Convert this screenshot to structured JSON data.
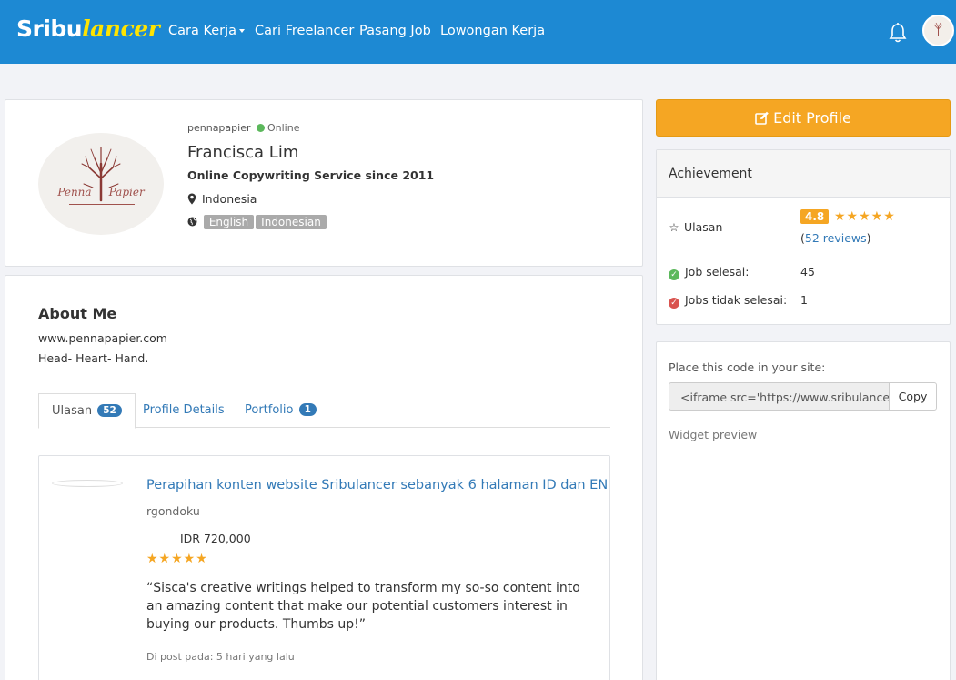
{
  "navbar": {
    "logo_white": "Sribu",
    "logo_yellow": "lancer",
    "items": [
      {
        "label": "Cara Kerja",
        "has_caret": true
      },
      {
        "label": "Cari Freelancer"
      },
      {
        "label": "Pasang Job"
      },
      {
        "label": "Lowongan Kerja"
      }
    ],
    "bell_icon": "bell-icon",
    "avatar_icon": "user-avatar"
  },
  "profile": {
    "username": "pennapapier",
    "status": "Online",
    "name": "Francisca Lim",
    "tagline": "Online Copywriting Service since 2011",
    "location": "Indonesia",
    "languages": [
      "English",
      "Indonesian"
    ],
    "photo_text_1": "Penna",
    "photo_text_2": "Papier"
  },
  "about": {
    "title": "About Me",
    "lines": [
      "www.pennapapier.com",
      "Head- Heart- Hand."
    ]
  },
  "tabs": [
    {
      "label": "Ulasan",
      "badge": "52",
      "active": true
    },
    {
      "label": "Profile Details"
    },
    {
      "label": "Portfolio",
      "badge": "1"
    }
  ],
  "review": {
    "title": "Perapihan konten website Sribulancer sebanyak 6 halaman ID dan EN",
    "reviewer": "rgondoku",
    "price": "IDR 720,000",
    "stars": "★★★★★",
    "rating": 5,
    "text": "“Sisca's creative writings helped to transform my so-so content into an amazing content that make our potential customers interest in buying our products. Thumbs up!”",
    "date": "Di post pada: 5 hari yang lalu"
  },
  "sidebar": {
    "edit_profile": "Edit Profile",
    "achievement_title": "Achievement",
    "ulasan_label": "Ulasan",
    "rating": "4.8",
    "rating_stars": "★★★★★",
    "reviews_open": "(",
    "reviews_count": "52 reviews",
    "reviews_close": ")",
    "job_done_label": "Job selesai:",
    "job_done_value": "45",
    "job_failed_label": "Jobs tidak selesai:",
    "job_failed_value": "1",
    "widget_label": "Place this code in your site:",
    "widget_code": "<iframe src='https://www.sribulancer",
    "copy_label": "Copy",
    "widget_preview": "Widget preview"
  },
  "colors": {
    "navbar": "#1d89d3",
    "accent_orange": "#f5a623",
    "link_blue": "#337ab7",
    "online_green": "#5cb85c",
    "danger_red": "#d9534f"
  }
}
